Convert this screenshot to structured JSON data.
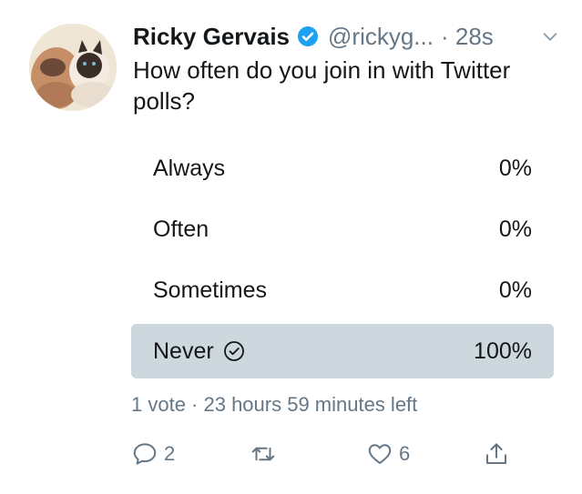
{
  "tweet": {
    "author_name": "Ricky Gervais",
    "handle": "@rickyg...",
    "time": "· 28s",
    "text": "How often do you join in with Twitter polls?"
  },
  "poll": {
    "options": [
      {
        "label": "Always",
        "percent": "0%"
      },
      {
        "label": "Often",
        "percent": "0%"
      },
      {
        "label": "Sometimes",
        "percent": "0%"
      },
      {
        "label": "Never",
        "percent": "100%",
        "selected": true
      }
    ],
    "meta": "1 vote · 23 hours 59 minutes left"
  },
  "actions": {
    "reply_count": "2",
    "retweet_count": "",
    "like_count": "6"
  },
  "colors": {
    "text": "#14171a",
    "secondary": "#657786",
    "winner_bar": "#cdd7de",
    "verified": "#1da1f2"
  },
  "icons": {
    "verified": "verified-badge-icon",
    "caret": "chevron-down-icon",
    "check": "check-circle-icon",
    "reply": "reply-icon",
    "retweet": "retweet-icon",
    "like": "heart-icon",
    "share": "share-icon"
  }
}
